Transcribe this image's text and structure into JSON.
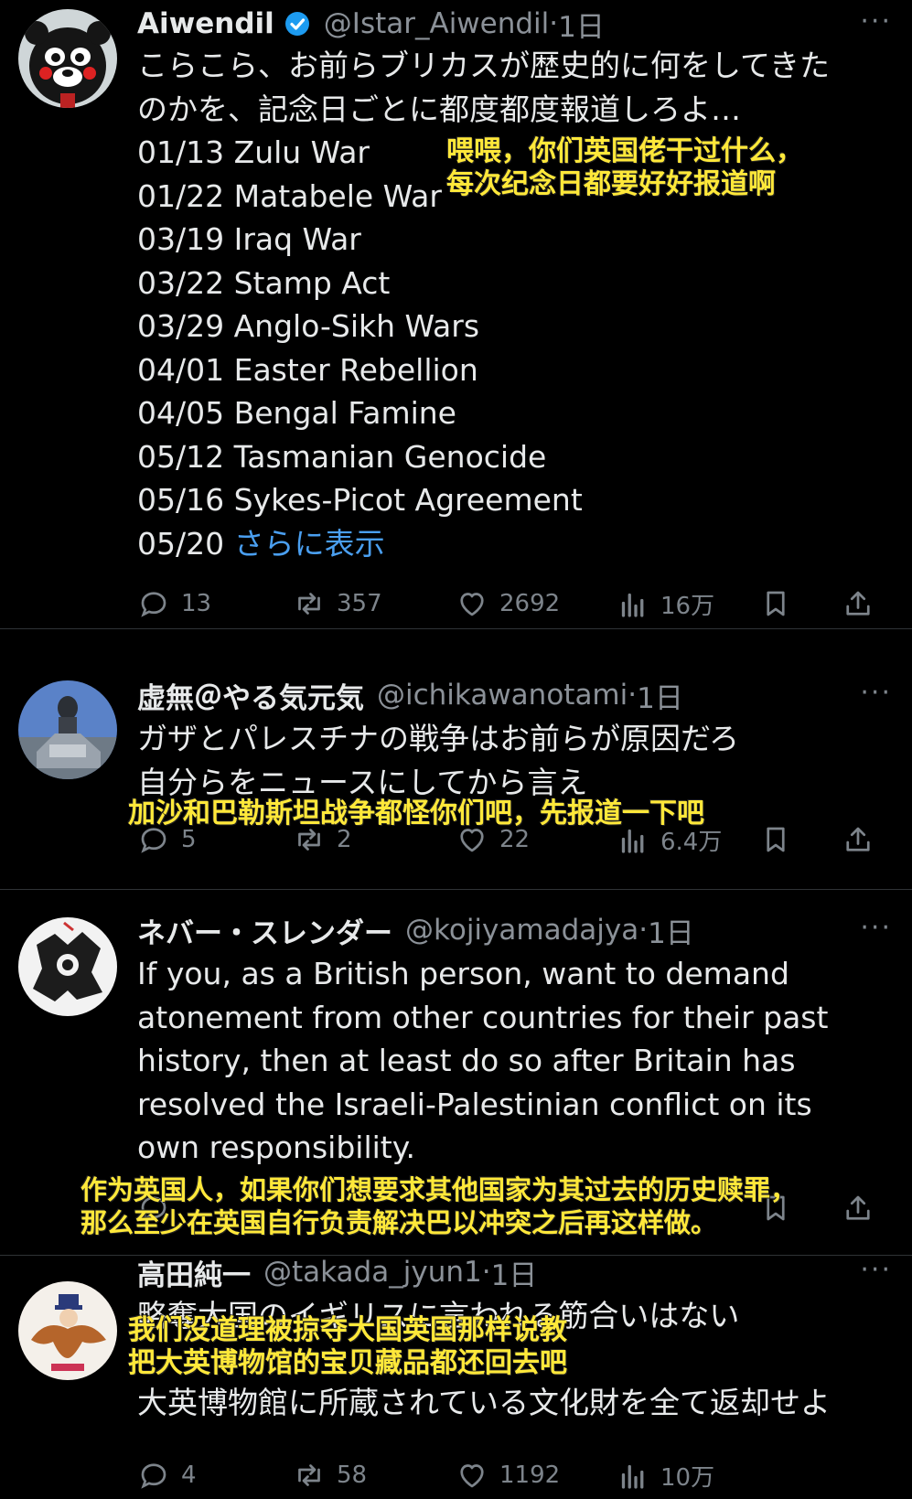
{
  "tweets": [
    {
      "name": "Aiwendil",
      "verified": true,
      "handle": "@Istar_Aiwendil",
      "sep": "·",
      "time": "1日",
      "lines": [
        "こらこら、お前らブリカスが歴史的に何をしてきた",
        "のかを、記念日ごとに都度都度報道しろよ…",
        "01/13 Zulu War",
        "01/22 Matabele War",
        "03/19 Iraq War",
        "03/22 Stamp Act",
        "03/29 Anglo-Sikh Wars",
        "04/01 Easter Rebellion",
        "04/05 Bengal Famine",
        "05/12 Tasmanian Genocide",
        "05/16 Sykes-Picot Agreement"
      ],
      "last_line_prefix": "05/20 ",
      "show_more": "さらに表示",
      "subtitle": [
        "喂喂，你们英国佬干过什么，",
        "每次纪念日都要好好报道啊"
      ],
      "replies": "13",
      "retweets": "357",
      "likes": "2692",
      "views": "16万"
    },
    {
      "name": "虚無＠やる気元気",
      "handle": "@ichikawanotami",
      "sep": "·",
      "time": "1日",
      "lines": [
        "ガザとパレスチナの戦争はお前らが原因だろ",
        "自分らをニュースにしてから言え"
      ],
      "subtitle": [
        "加沙和巴勒斯坦战争都怪你们吧，先报道一下吧"
      ],
      "replies": "5",
      "retweets": "2",
      "likes": "22",
      "views": "6.4万"
    },
    {
      "name": "ネバー・スレンダー",
      "handle": "@kojiyamadajya",
      "sep": "·",
      "time": "1日",
      "lines": [
        "If you, as a British person, want to demand",
        "atonement from other countries for their past",
        "history, then at least do so after Britain has",
        "resolved the Israeli-Palestinian conflict on its",
        "own responsibility."
      ],
      "subtitle": [
        "作为英国人，如果你们想要求其他国家为其过去的历史赎罪，",
        "那么至少在英国自行负责解决巴以冲突之后再这样做。"
      ]
    },
    {
      "name": "高田純一",
      "handle": "@takada_jyun1",
      "sep": "·",
      "time": "1日",
      "lines": [
        "略奪大国のイギリスに言われる筋合いはない",
        "",
        "大英博物館に所蔵されている文化財を全て返却せよ"
      ],
      "subtitle": [
        "我们没道理被掠夺大国英国那样说教",
        "把大英博物馆的宝贝藏品都还回去吧"
      ],
      "replies": "4",
      "retweets": "58",
      "likes": "1192",
      "views": "10万"
    }
  ],
  "more_icon": "···",
  "icons": [
    "reply-icon",
    "retweet-icon",
    "like-icon",
    "views-icon",
    "bookmark-icon",
    "share-icon",
    "verified-icon",
    "more-icon"
  ],
  "colors": {
    "background": "#000000",
    "text": "#e7e9ea",
    "muted": "#7d848b",
    "link": "#4a9ff0",
    "subtitle": "#ffe83a",
    "verified": "#1d9bf0"
  }
}
